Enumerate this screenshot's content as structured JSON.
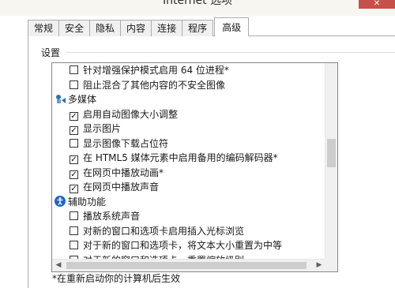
{
  "window": {
    "title": "Internet 选项",
    "close_glyph": "✕"
  },
  "tabs": [
    {
      "label": "常规",
      "active": false
    },
    {
      "label": "安全",
      "active": false
    },
    {
      "label": "隐私",
      "active": false
    },
    {
      "label": "内容",
      "active": false
    },
    {
      "label": "连接",
      "active": false
    },
    {
      "label": "程序",
      "active": false
    },
    {
      "label": "高级",
      "active": true
    }
  ],
  "settings": {
    "group_label": "设置",
    "rows": [
      {
        "type": "item",
        "label": "针对增强保护模式启用 64 位进程*",
        "checked": false
      },
      {
        "type": "item",
        "label": "阻止混合了其他内容的不安全图像",
        "checked": false
      },
      {
        "type": "category",
        "label": "多媒体",
        "icon": "multimedia-icon"
      },
      {
        "type": "item",
        "label": "启用自动图像大小调整",
        "checked": true
      },
      {
        "type": "item",
        "label": "显示图片",
        "checked": true
      },
      {
        "type": "item",
        "label": "显示图像下载占位符",
        "checked": false
      },
      {
        "type": "item",
        "label": "在 HTML5 媒体元素中启用备用的编码解码器*",
        "checked": true
      },
      {
        "type": "item",
        "label": "在网页中播放动画*",
        "checked": true
      },
      {
        "type": "item",
        "label": "在网页中播放声音",
        "checked": true
      },
      {
        "type": "category",
        "label": "辅助功能",
        "icon": "accessibility-icon"
      },
      {
        "type": "item",
        "label": "播放系统声音",
        "checked": false
      },
      {
        "type": "item",
        "label": "对新的窗口和选项卡启用插入光标浏览",
        "checked": false
      },
      {
        "type": "item",
        "label": "对于新的窗口和选项卡，将文本大小重置为中等",
        "checked": false
      },
      {
        "type": "item",
        "label": "对于新的窗口和选项卡，重置缩放级别",
        "checked": false
      }
    ],
    "scroll_left_glyph": "◀",
    "scroll_right_glyph": "▶",
    "check_glyph": "✓"
  },
  "footnote": "*在重新启动你的计算机后生效",
  "colors": {
    "close_button": "#c7504a",
    "multimedia_icon": "#2f6fb5",
    "accessibility_icon": "#1f64c8"
  }
}
